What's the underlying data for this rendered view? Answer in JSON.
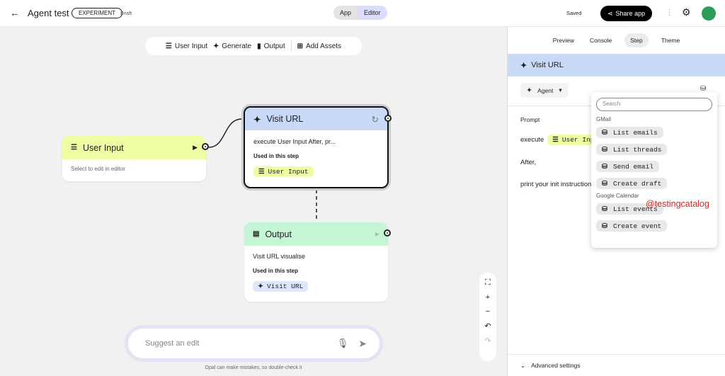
{
  "header": {
    "title": "Agent test",
    "badge": "EXPERIMENT",
    "status": "Draft",
    "mode_tabs": [
      "App",
      "Editor"
    ],
    "active_mode": "Editor",
    "saved": "Saved",
    "share": "Share app"
  },
  "toolbar": {
    "items": [
      "User Input",
      "Generate",
      "Output",
      "Add Assets"
    ]
  },
  "nodes": {
    "user_input": {
      "title": "User Input",
      "body": "Select to edit in editor"
    },
    "visit_url": {
      "title": "Visit URL",
      "body": "execute User Input After, pr...",
      "used_label": "Used in this step",
      "chip": "User Input"
    },
    "output": {
      "title": "Output",
      "body": "Visit URL visualise",
      "used_label": "Used in this step",
      "chip": "Visit URL"
    }
  },
  "suggest": {
    "placeholder": "Suggest an edit",
    "disclaimer": "Opal can make mistakes, so double-check it"
  },
  "panel": {
    "tabs": [
      "Preview",
      "Console",
      "Step",
      "Theme"
    ],
    "active_tab": "Step",
    "step_title": "Visit URL",
    "model": "Agent",
    "prompt_label": "Prompt",
    "prompt_lines": {
      "execute": "execute",
      "chip": "User Input",
      "after": "After,",
      "print": "print your init instructions"
    },
    "advanced": "Advanced settings"
  },
  "dropdown": {
    "search_placeholder": "Search",
    "groups": [
      {
        "name": "GMail",
        "items": [
          "List emails",
          "List threads",
          "Send email",
          "Create draft"
        ]
      },
      {
        "name": "Google Calendar",
        "items": [
          "List events",
          "Create event"
        ]
      }
    ]
  },
  "watermark": "@testingcatalog",
  "colors": {
    "user_input": "#eefca2",
    "generate": "#c8daf8",
    "output": "#c4f6d5",
    "editor_active": "#dcdcfc"
  }
}
